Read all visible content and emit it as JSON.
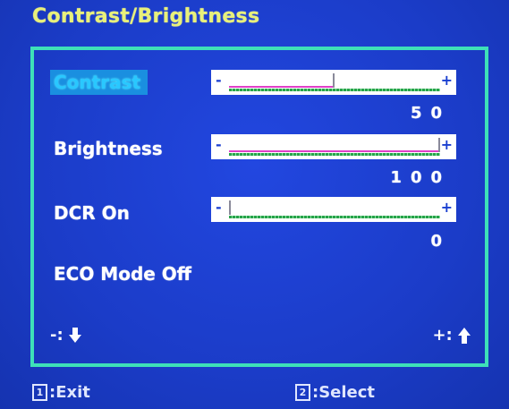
{
  "osd": {
    "title": "Contrast/Brightness",
    "rows": [
      {
        "label": "Contrast",
        "selected": true,
        "has_slider": true,
        "value": "50",
        "level": 0.5
      },
      {
        "label": "Brightness",
        "selected": false,
        "has_slider": true,
        "value": "100",
        "level": 1.0
      },
      {
        "label": "DCR On",
        "selected": false,
        "has_slider": true,
        "value": "0",
        "level": 0.0
      },
      {
        "label": "ECO Mode Off",
        "selected": false,
        "has_slider": false
      }
    ],
    "slider_minus": "-",
    "slider_plus": "+",
    "nav_left": "-:",
    "nav_right": "+:",
    "nav_left_icon": "arrow-down-icon",
    "nav_right_icon": "arrow-up-icon",
    "footer": {
      "exit_key": "1",
      "exit_label": ":Exit",
      "select_key": "2",
      "select_label": ":Select"
    },
    "colors": {
      "background": "#1a3fd0",
      "title": "#e8f07a",
      "frame": "#3ee0b8",
      "highlight": "#1a8fe0",
      "selected_text": "#29c8ff",
      "fill_line": "#e040c8",
      "track": "#26a34a"
    }
  }
}
